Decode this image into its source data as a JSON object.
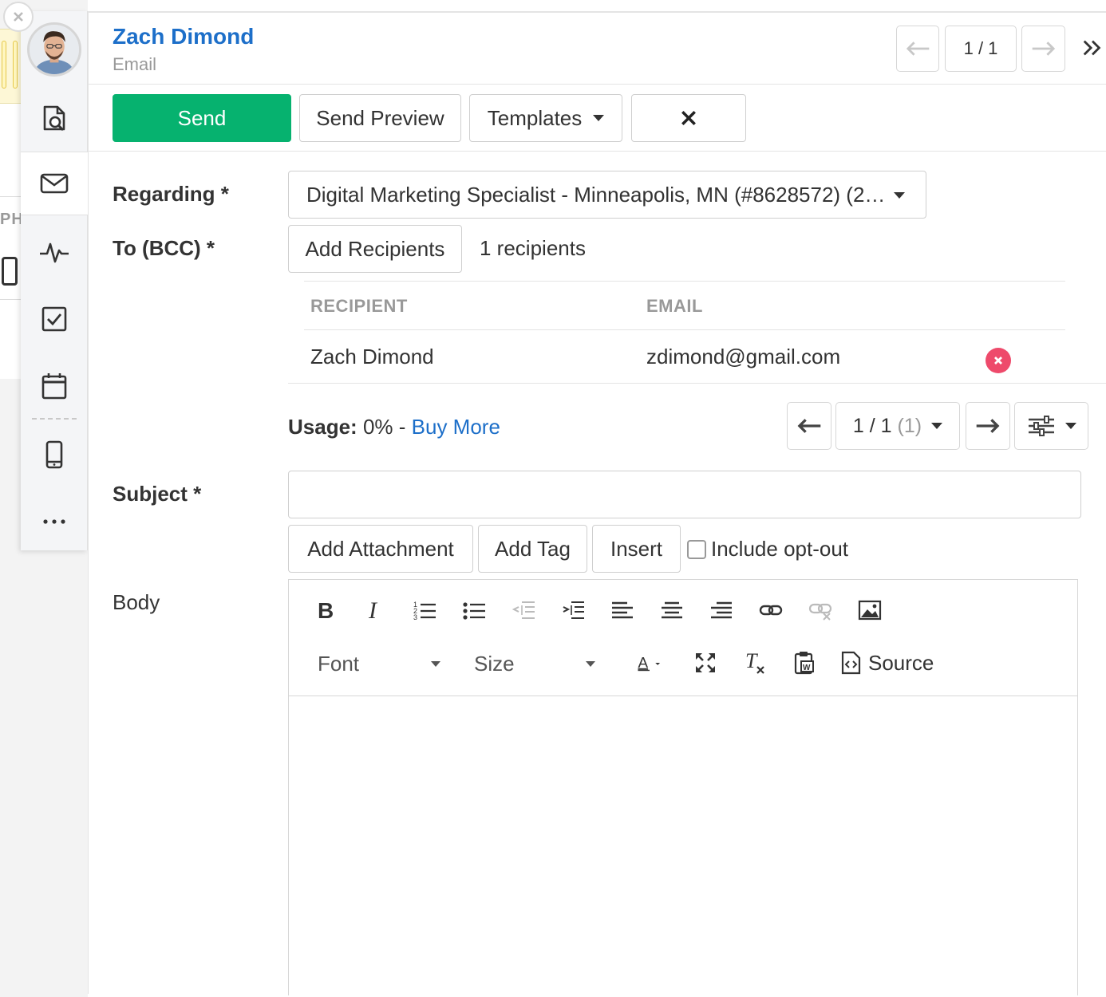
{
  "contact": {
    "name": "Zach Dimond",
    "subtitle": "Email"
  },
  "nav": {
    "page": "1 / 1"
  },
  "toolbar": {
    "send": "Send",
    "send_preview": "Send Preview",
    "templates": "Templates"
  },
  "form": {
    "regarding_label": "Regarding *",
    "regarding_value": "Digital Marketing Specialist - Minneapolis, MN (#8628572) (2…",
    "to_label": "To (BCC) *",
    "add_recipients": "Add Recipients",
    "recipient_count": "1 recipients",
    "subject_label": "Subject *",
    "subject_value": "",
    "body_label": "Body",
    "add_attachment": "Add Attachment",
    "add_tag": "Add Tag",
    "insert": "Insert",
    "include_optout": "Include opt-out"
  },
  "recipients": {
    "col_recipient": "RECIPIENT",
    "col_email": "EMAIL",
    "rows": [
      {
        "name": "Zach Dimond",
        "email": "zdimond@gmail.com"
      }
    ]
  },
  "usage": {
    "label": "Usage:",
    "value": "0% -",
    "buy_more": "Buy More",
    "pager": "1 / 1",
    "pager_count": "(1)"
  },
  "editor": {
    "font": "Font",
    "size": "Size",
    "source": "Source"
  },
  "background": {
    "ph": "PH"
  },
  "colors": {
    "accent_blue": "#1d6fc9",
    "send_green": "#06b26f",
    "remove_red": "#ee4a6b"
  }
}
